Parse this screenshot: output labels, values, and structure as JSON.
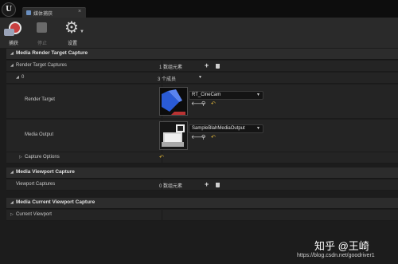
{
  "window": {
    "logo_text": "U",
    "tab_title": "媒体捕获",
    "tab_close": "×"
  },
  "toolbar": {
    "capture_label": "捕获",
    "stop_label": "停止",
    "settings_label": "设置"
  },
  "sections": {
    "render_target": {
      "title": "Media Render Target Capture",
      "captures_label": "Render Target Captures",
      "captures_count": "1 数组元素",
      "index_label": "0",
      "index_value": "3 个成员",
      "render_target_label": "Render Target",
      "render_target_value": "RT_CineCam",
      "media_output_label": "Media Output",
      "media_output_value": "SampleBlahMediaOutput",
      "capture_options_label": "Capture Options"
    },
    "viewport": {
      "title": "Media Viewport Capture",
      "captures_label": "Viewport Captures",
      "captures_count": "0 数组元素"
    },
    "current_viewport": {
      "title": "Media Current Viewport Capture",
      "current_label": "Current Viewport"
    }
  },
  "watermark": {
    "text": "知乎 @王崎",
    "url": "https://blog.csdn.net/goodriver1"
  },
  "colors": {
    "accent_reset": "#d9b13a",
    "capture_red": "#c94040"
  }
}
